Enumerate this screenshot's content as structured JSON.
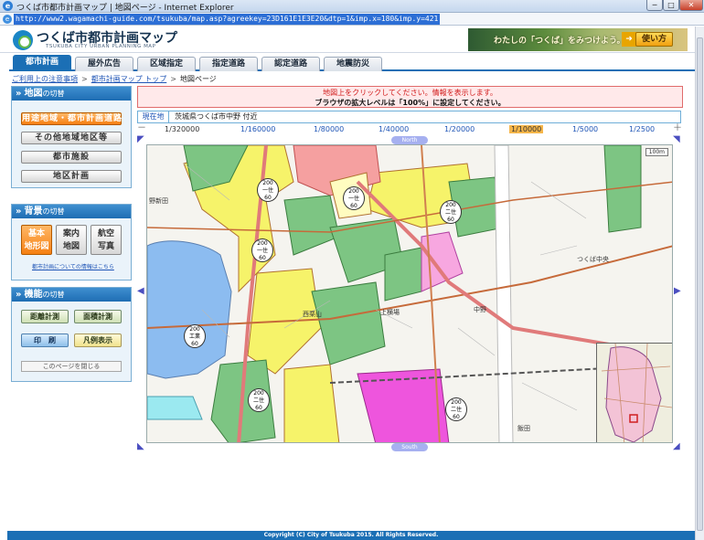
{
  "window": {
    "title": "つくば市都市計画マップ | 地図ページ - Internet Explorer",
    "minimize": "─",
    "maximize": "□",
    "close": "✕"
  },
  "address": {
    "url": "http://www2.wagamachi-guide.com/tsukuba/map.asp?agreekey=23D161E1E3E20&dtp=1&imp.x=180&imp.y=421"
  },
  "header": {
    "logo_title": "つくば市都市計画マップ",
    "logo_sub": "TSUKUBA CITY URBAN PLANNING MAP",
    "banner_text": "わたしの「つくば」をみつけよう。",
    "banner_button": "使い方"
  },
  "tabs": [
    "都市計画",
    "屋外広告",
    "区域指定",
    "指定道路",
    "認定道路",
    "地震防災"
  ],
  "breadcrumb": {
    "items": [
      "ご利用上の注意事項",
      "都市計画マップ トップ"
    ],
    "current": "地図ページ",
    "separator": ">"
  },
  "sidebar": {
    "map_switch": {
      "title": "地図",
      "title_suffix": "の切替",
      "buttons": [
        "用途地域・都市計画道路",
        "その他地域地区等",
        "都市施設",
        "地区計画"
      ]
    },
    "background_switch": {
      "title": "背景",
      "title_suffix": "の切替",
      "options": [
        {
          "line1": "基本",
          "line2": "地形図"
        },
        {
          "line1": "案内",
          "line2": "地図"
        },
        {
          "line1": "航空",
          "line2": "写真"
        }
      ],
      "help_link": "都市計画についての情報はこちら"
    },
    "functions": {
      "title": "機能",
      "title_suffix": "の切替",
      "buttons": [
        "距離計測",
        "面積計測",
        "印　刷",
        "凡例表示"
      ],
      "close_page": "このページを閉じる"
    }
  },
  "notice": {
    "line1": "地図上をクリックしてください。情報を表示します。",
    "line2": "ブラウザの拡大レベルは「100%」に設定してください。"
  },
  "location": {
    "label": "現在地",
    "value": "茨城県つくば市中野 付近"
  },
  "scales": {
    "items": [
      "1/320000",
      "1/160000",
      "1/80000",
      "1/40000",
      "1/20000",
      "1/10000",
      "1/5000",
      "1/2500"
    ],
    "selected": "1/10000",
    "minus": "－",
    "plus": "＋"
  },
  "map": {
    "north_label": "North",
    "south_label": "South",
    "scale_badge": "100m",
    "place_labels": [
      "野新田",
      "中野",
      "西栗山",
      "上横場",
      "飯田",
      "つくば中央"
    ],
    "zone_labels": [
      {
        "top": "200",
        "mid": "一住",
        "bot": "60"
      },
      {
        "top": "200",
        "mid": "一住",
        "bot": "60"
      },
      {
        "top": "200",
        "mid": "二住",
        "bot": "60"
      },
      {
        "top": "200",
        "mid": "一住",
        "bot": "60"
      },
      {
        "top": "200",
        "mid": "工業",
        "bot": "60"
      },
      {
        "top": "200",
        "mid": "二住",
        "bot": "60"
      },
      {
        "top": "200",
        "mid": "二住",
        "bot": "60"
      }
    ]
  },
  "footer": {
    "text": "Copyright (C) City of Tsukuba 2015. All Rights Reserved."
  }
}
